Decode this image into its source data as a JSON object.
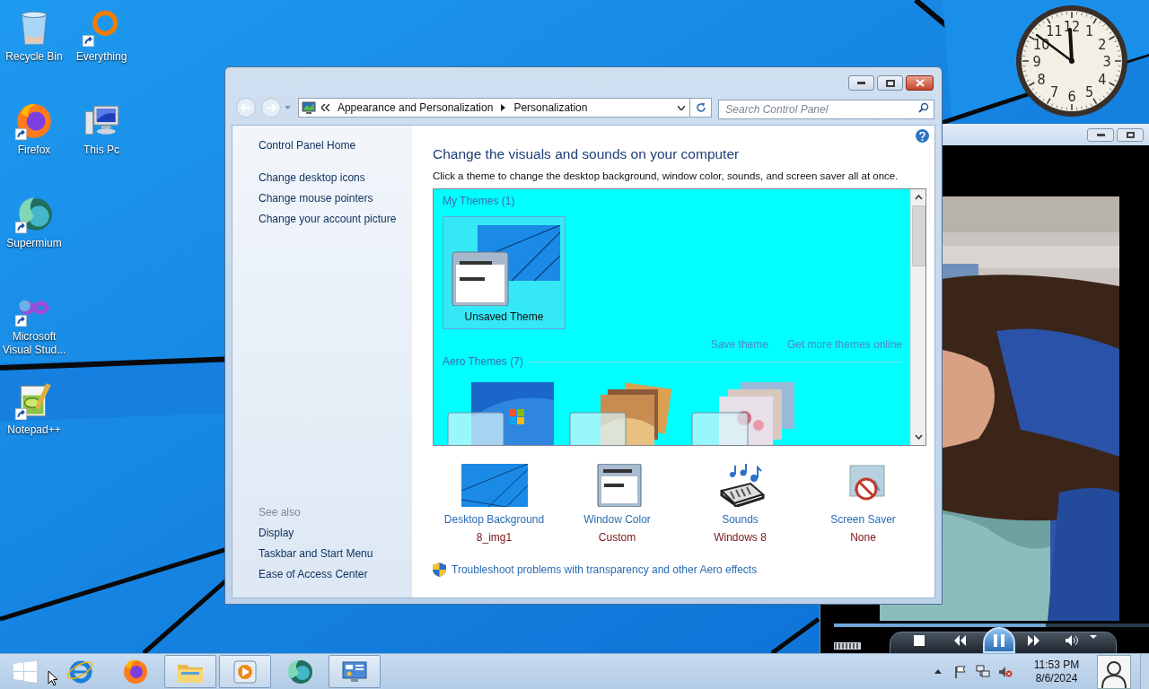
{
  "desktop_icons": [
    {
      "label": "Recycle Bin",
      "kind": "recycle-bin",
      "shortcut": false
    },
    {
      "label": "Everything",
      "kind": "everything",
      "shortcut": true
    },
    {
      "label": "Firefox",
      "kind": "firefox",
      "shortcut": true
    },
    {
      "label": "This Pc",
      "kind": "computer",
      "shortcut": false
    },
    {
      "label": "Supermium",
      "kind": "supermium",
      "shortcut": true
    },
    {
      "label": "Microsoft Visual Stud...",
      "kind": "visual-studio",
      "shortcut": true
    },
    {
      "label": "Notepad++",
      "kind": "notepad",
      "shortcut": true
    }
  ],
  "clock": {
    "numerals": [
      "12",
      "11",
      "1",
      "10",
      "2",
      "9",
      "3",
      "8",
      "4",
      "7",
      "5",
      "6"
    ]
  },
  "media_player": {
    "seek": {
      "level": 0.67
    }
  },
  "window": {
    "address": [
      "Appearance and Personalization",
      "Personalization"
    ],
    "search": {
      "placeholder": "Search Control Panel"
    },
    "sidebar": {
      "links": [
        "Control Panel Home",
        "Change desktop icons",
        "Change mouse pointers",
        "Change your account picture"
      ],
      "see_also": {
        "title": "See also",
        "links": [
          "Display",
          "Taskbar and Start Menu",
          "Ease of Access Center"
        ]
      }
    },
    "heading": "Change the visuals and sounds on your computer",
    "description": "Click a theme to change the desktop background, window color, sounds, and screen saver all at once.",
    "my_themes": {
      "title": "My Themes (1)",
      "items": [
        {
          "label": "Unsaved Theme",
          "selected": true
        }
      ]
    },
    "theme_links": [
      "Save theme",
      "Get more themes online"
    ],
    "aero_themes": {
      "title": "Aero Themes (7)",
      "items": [
        {
          "kind": "windows",
          "selected": false
        },
        {
          "kind": "photos",
          "selected": false
        },
        {
          "kind": "flowers",
          "selected": false
        }
      ]
    },
    "settings": [
      {
        "kind": "background",
        "label": "Desktop Background",
        "value": "8_img1"
      },
      {
        "kind": "color",
        "label": "Window Color",
        "value": "Custom"
      },
      {
        "kind": "sounds",
        "label": "Sounds",
        "value": "Windows 8"
      },
      {
        "kind": "screensaver",
        "label": "Screen Saver",
        "value": "None"
      }
    ],
    "troubleshoot": "Troubleshoot problems with transparency and other Aero effects"
  },
  "taskbar": {
    "items": [
      {
        "kind": "ie",
        "open": false
      },
      {
        "kind": "firefox",
        "open": false
      },
      {
        "kind": "explorer",
        "open": true
      },
      {
        "kind": "media",
        "open": true
      },
      {
        "kind": "supermium",
        "open": false
      },
      {
        "kind": "control-panel",
        "open": true
      }
    ],
    "time": "11:53 PM",
    "date": "8/6/2024"
  }
}
